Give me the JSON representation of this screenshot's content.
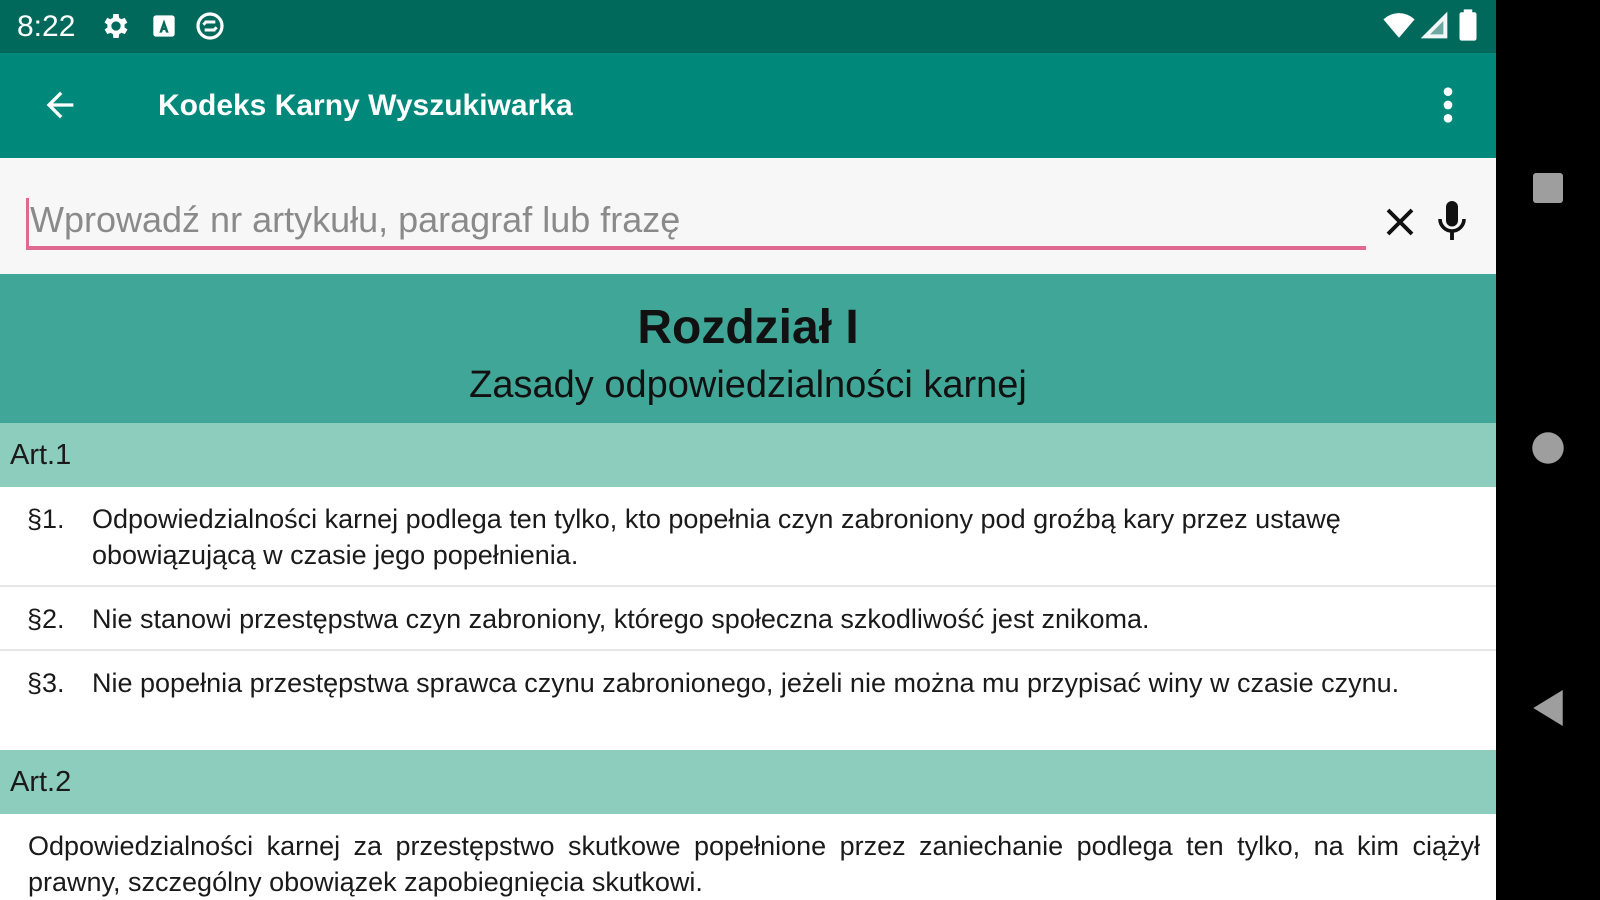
{
  "status_bar": {
    "time": "8:22",
    "icons": [
      "settings-icon",
      "a-notification-icon",
      "sync-icon",
      "wifi-icon",
      "signal-icon",
      "battery-icon"
    ]
  },
  "app_bar": {
    "title": "Kodeks Karny Wyszukiwarka",
    "back_icon": "arrow-left-icon",
    "menu_icon": "more-vert-icon"
  },
  "search": {
    "placeholder": "Wprowadź nr artykułu, paragraf lub frazę",
    "value": "",
    "clear_icon": "close-icon",
    "mic_icon": "mic-icon",
    "accent_color": "#e0698f"
  },
  "chapter": {
    "title": "Rozdział I",
    "subtitle": "Zasady odpowiedzialności karnej"
  },
  "articles": [
    {
      "label": "Art.1",
      "paragraphs": [
        {
          "num": "§1.",
          "text": "Odpowiedzialności karnej podlega ten tylko, kto popełnia czyn zabroniony pod groźbą kary przez ustawę obowiązującą w czasie jego popełnienia."
        },
        {
          "num": "§2.",
          "text": "Nie stanowi przestępstwa czyn zabroniony, którego społeczna szkodliwość jest znikoma."
        },
        {
          "num": "§3.",
          "text": "Nie popełnia przestępstwa sprawca czynu zabronionego, jeżeli nie można mu przypisać winy w czasie czynu."
        }
      ]
    },
    {
      "label": "Art.2",
      "text": "Odpowiedzialności karnej za przestępstwo skutkowe popełnione przez zaniechanie podlega ten tylko, na kim ciążył prawny, szczególny obowiązek zapobiegnięcia skutkowi."
    }
  ],
  "nav_bar": {
    "icons": [
      "recents-square-icon",
      "home-circle-icon",
      "back-triangle-icon"
    ]
  },
  "colors": {
    "status_bar": "#00695c",
    "app_bar": "#00897b",
    "chapter_bg": "#40a697",
    "article_header_bg": "#8dcdbd"
  }
}
